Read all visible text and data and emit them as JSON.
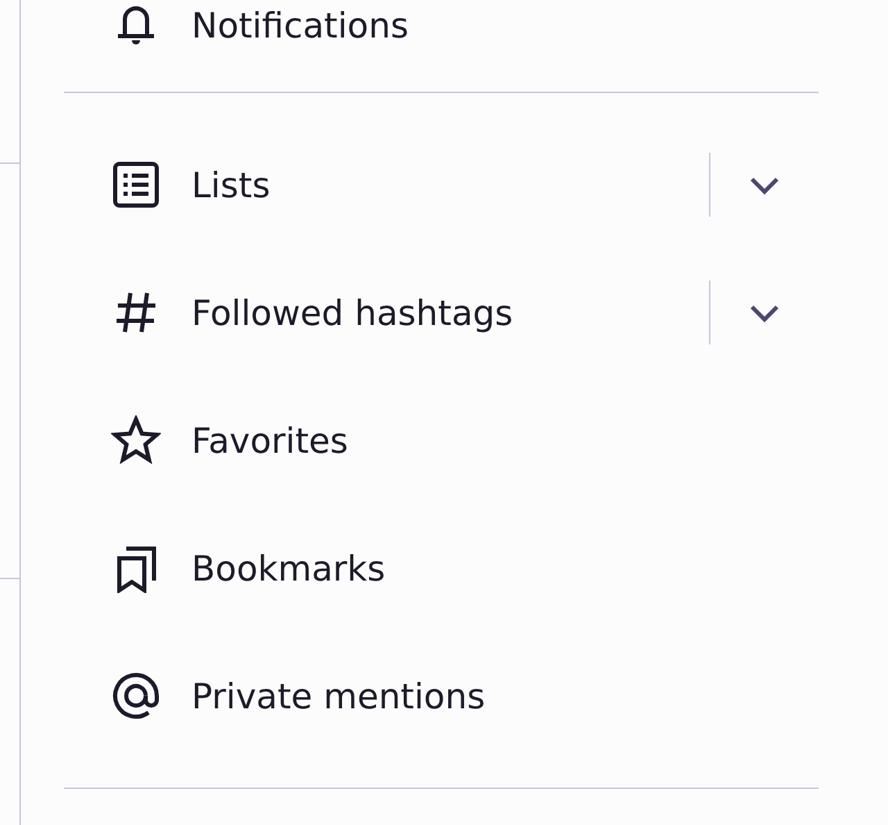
{
  "top_item": {
    "label": "Notifications"
  },
  "items": [
    {
      "label": "Lists",
      "kind": "expandable",
      "expanded": false
    },
    {
      "label": "Followed hashtags",
      "kind": "expandable",
      "expanded": false
    },
    {
      "label": "Favorites",
      "kind": "link"
    },
    {
      "label": "Bookmarks",
      "kind": "link"
    },
    {
      "label": "Private mentions",
      "kind": "link"
    }
  ]
}
